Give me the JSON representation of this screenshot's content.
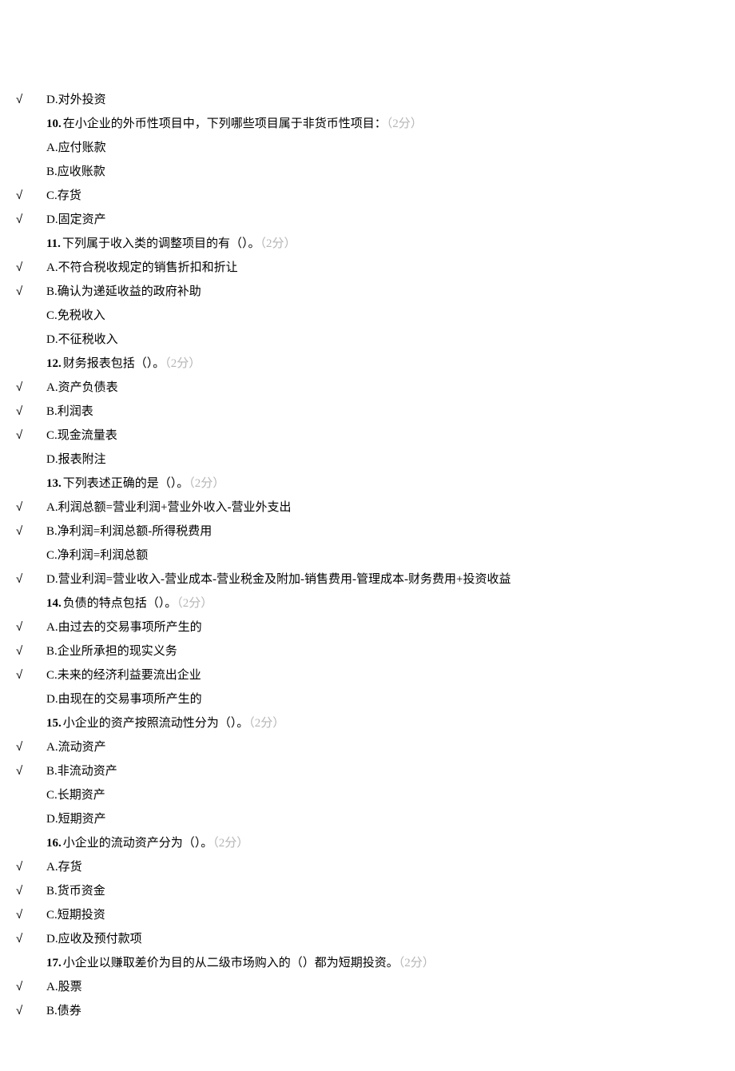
{
  "check_mark": "√",
  "orphan": {
    "letter": "D.",
    "text": "对外投资",
    "marked": true
  },
  "questions": [
    {
      "num": "10.",
      "text": "在小企业的外币性项目中，下列哪些项目属于非货币性项目：",
      "points": "（2分）",
      "options": [
        {
          "letter": "A.",
          "text": "应付账款",
          "marked": false
        },
        {
          "letter": "B.",
          "text": "应收账款",
          "marked": false
        },
        {
          "letter": "C.",
          "text": "存货",
          "marked": true
        },
        {
          "letter": "D.",
          "text": "固定资产",
          "marked": true
        }
      ]
    },
    {
      "num": "11.",
      "text": "下列属于收入类的调整项目的有（）。",
      "points": "（2分）",
      "options": [
        {
          "letter": "A.",
          "text": "不符合税收规定的销售折扣和折让",
          "marked": true
        },
        {
          "letter": "B.",
          "text": "确认为递延收益的政府补助",
          "marked": true
        },
        {
          "letter": "C.",
          "text": "免税收入",
          "marked": false
        },
        {
          "letter": "D.",
          "text": "不征税收入",
          "marked": false
        }
      ]
    },
    {
      "num": "12.",
      "text": "财务报表包括（）。",
      "points": "（2分）",
      "options": [
        {
          "letter": "A.",
          "text": "资产负债表",
          "marked": true
        },
        {
          "letter": "B.",
          "text": "利润表",
          "marked": true
        },
        {
          "letter": "C.",
          "text": "现金流量表",
          "marked": true
        },
        {
          "letter": "D.",
          "text": "报表附注",
          "marked": false
        }
      ]
    },
    {
      "num": "13.",
      "text": "下列表述正确的是（）。",
      "points": "（2分）",
      "options": [
        {
          "letter": "A.",
          "text": "利润总额=营业利润+营业外收入-营业外支出",
          "marked": true
        },
        {
          "letter": "B.",
          "text": "净利润=利润总额-所得税费用",
          "marked": true
        },
        {
          "letter": "C.",
          "text": "净利润=利润总额",
          "marked": false
        },
        {
          "letter": "D.",
          "text": "营业利润=营业收入-营业成本-营业税金及附加-销售费用-管理成本-财务费用+投资收益",
          "marked": true
        }
      ]
    },
    {
      "num": "14.",
      "text": "负债的特点包括（）。",
      "points": "（2分）",
      "options": [
        {
          "letter": "A.",
          "text": "由过去的交易事项所产生的",
          "marked": true
        },
        {
          "letter": "B.",
          "text": "企业所承担的现实义务",
          "marked": true
        },
        {
          "letter": "C.",
          "text": "未来的经济利益要流出企业",
          "marked": true
        },
        {
          "letter": "D.",
          "text": "由现在的交易事项所产生的",
          "marked": false
        }
      ]
    },
    {
      "num": "15.",
      "text": "小企业的资产按照流动性分为（）。",
      "points": "（2分）",
      "options": [
        {
          "letter": "A.",
          "text": "流动资产",
          "marked": true
        },
        {
          "letter": "B.",
          "text": "非流动资产",
          "marked": true
        },
        {
          "letter": "C.",
          "text": "长期资产",
          "marked": false
        },
        {
          "letter": "D.",
          "text": "短期资产",
          "marked": false
        }
      ]
    },
    {
      "num": "16.",
      "text": "小企业的流动资产分为（）。",
      "points": "（2分）",
      "options": [
        {
          "letter": "A.",
          "text": "存货",
          "marked": true
        },
        {
          "letter": "B.",
          "text": "货币资金",
          "marked": true
        },
        {
          "letter": "C.",
          "text": "短期投资",
          "marked": true
        },
        {
          "letter": "D.",
          "text": "应收及预付款项",
          "marked": true
        }
      ]
    },
    {
      "num": "17.",
      "text": "小企业以赚取差价为目的从二级市场购入的（）都为短期投资。",
      "points": "（2分）",
      "options": [
        {
          "letter": "A.",
          "text": "股票",
          "marked": true
        },
        {
          "letter": "B.",
          "text": "债券",
          "marked": true
        }
      ]
    }
  ]
}
